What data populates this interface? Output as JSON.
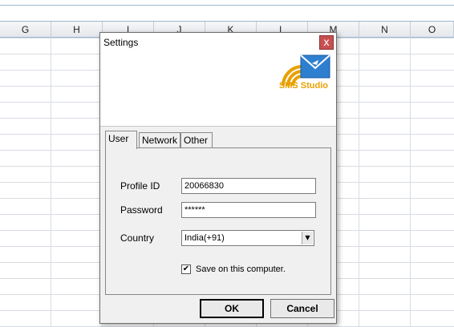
{
  "spreadsheet": {
    "columns": [
      "G",
      "H",
      "I",
      "J",
      "K",
      "L",
      "M",
      "N",
      "O"
    ]
  },
  "dialog": {
    "title": "Settings",
    "close_label": "x",
    "logo_text": "SMS Studio",
    "tabs": [
      {
        "label": "User",
        "active": true
      },
      {
        "label": "Network",
        "active": false
      },
      {
        "label": "Other",
        "active": false
      }
    ],
    "fields": {
      "profile_id": {
        "label": "Profile ID",
        "value": "20066830"
      },
      "password": {
        "label": "Password",
        "value": "******"
      },
      "country": {
        "label": "Country",
        "value": "India(+91)"
      }
    },
    "save_checkbox": {
      "label": "Save on this computer.",
      "checked": true,
      "mark": "✔"
    },
    "buttons": {
      "ok": "OK",
      "cancel": "Cancel"
    }
  }
}
